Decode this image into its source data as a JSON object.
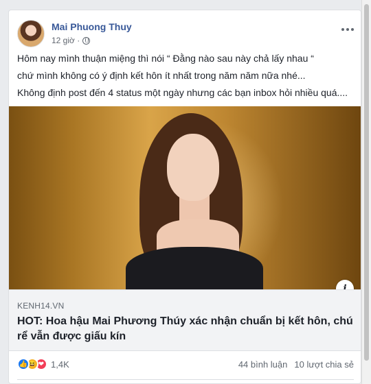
{
  "post": {
    "author": "Mai Phuong Thuy",
    "time": "12 giờ ·",
    "text_lines": [
      "Hôm nay mình thuận miệng thì nói “ Đằng nào sau này chả lấy nhau “",
      "chứ mình không có ý định kết hôn ít nhất trong năm năm nữa nhé...",
      "Không định post đến 4 status một ngày nhưng các bạn inbox hỏi nhiều quá...."
    ]
  },
  "link": {
    "domain": "KENH14.VN",
    "title": "HOT: Hoa hậu Mai Phương Thúy xác nhận chuẩn bị kết hôn, chú rể vẫn được giấu kín",
    "info_label": "i"
  },
  "stats": {
    "reactions_count": "1,4K",
    "comments": "44 bình luận",
    "shares": "10 lượt chia sẻ",
    "reaction_icons": [
      "like-icon",
      "haha-icon",
      "love-icon"
    ]
  },
  "colors": {
    "author_link": "#385898",
    "like": "#1877f2",
    "haha": "#f7b125",
    "love": "#f33e58"
  }
}
